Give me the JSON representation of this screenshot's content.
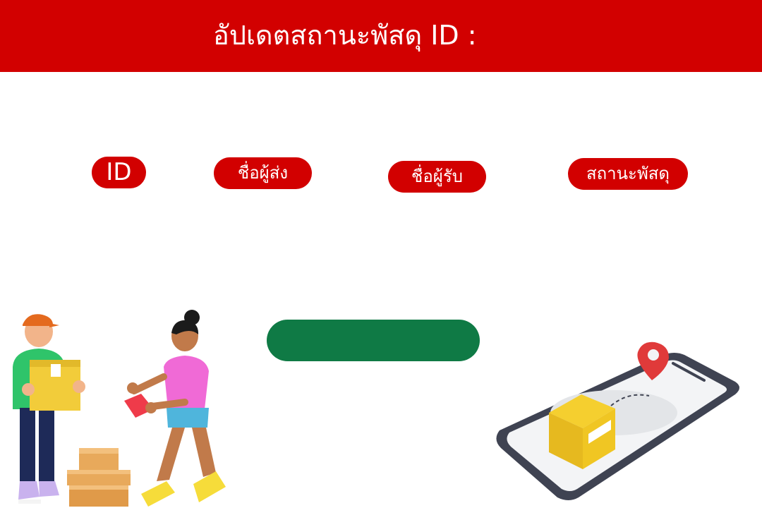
{
  "header": {
    "title": "อัปเดตสถานะพัสดุ ID :"
  },
  "fields": {
    "id_label": "ID",
    "sender_label": "ชื่อผู้ส่ง",
    "receiver_label": "ชื่อผู้รับ",
    "status_label": "สถานะพัสดุ"
  },
  "actions": {
    "update_button_label": ""
  },
  "colors": {
    "header_bg": "#d20000",
    "pill_bg": "#d20000",
    "button_bg": "#0f7a45",
    "text_light": "#ffffff"
  },
  "illustrations": {
    "left": "delivery-people-illustration",
    "right": "phone-tracking-illustration"
  }
}
